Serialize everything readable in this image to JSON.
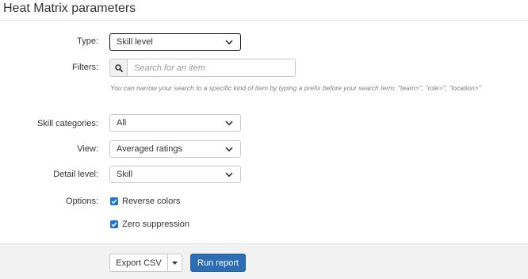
{
  "page": {
    "title": "Heat Matrix parameters"
  },
  "form": {
    "type": {
      "label": "Type:",
      "value": "Skill level"
    },
    "filters": {
      "label": "Filters:",
      "placeholder": "Search for an item",
      "help": "You can narrow your search to a specific kind of item by typing a prefix before your search term: \"team>\", \"role>\", \"location>\""
    },
    "skill_categories": {
      "label": "Skill categories:",
      "value": "All"
    },
    "view": {
      "label": "View:",
      "value": "Averaged ratings"
    },
    "detail_level": {
      "label": "Detail level:",
      "value": "Skill"
    },
    "options": {
      "label": "Options:",
      "reverse_colors": {
        "label": "Reverse colors",
        "checked": true
      },
      "zero_suppression": {
        "label": "Zero suppression",
        "checked": true
      }
    }
  },
  "footer": {
    "export_label": "Export CSV",
    "run_label": "Run report"
  },
  "colors": {
    "accent": "#2d6db3",
    "checkbox": "#1a73d9",
    "footer_bg": "#f2f2f2"
  },
  "icons": {
    "search": "search-icon",
    "chevron": "chevron-down-icon",
    "check": "check-icon",
    "caret": "caret-down-icon"
  }
}
